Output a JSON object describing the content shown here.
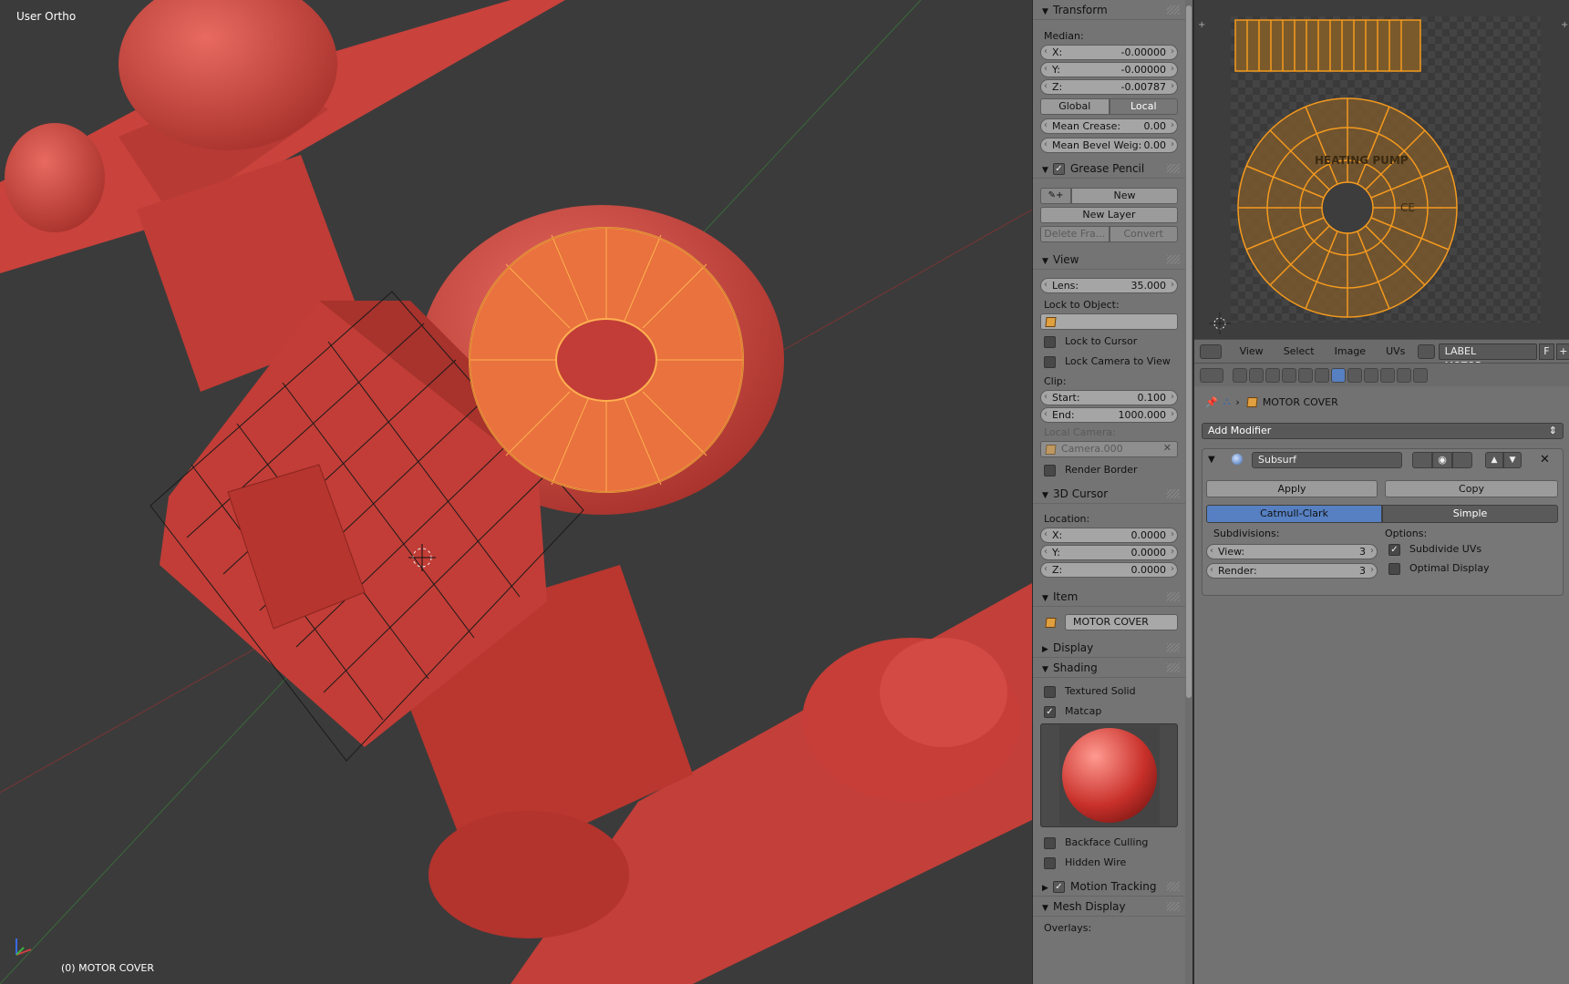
{
  "viewport": {
    "view_name": "User Ortho",
    "object_label": "(0) MOTOR COVER"
  },
  "transform": {
    "title": "Transform",
    "median_label": "Median:",
    "x": {
      "k": "X:",
      "v": "-0.00000"
    },
    "y": {
      "k": "Y:",
      "v": "-0.00000"
    },
    "z": {
      "k": "Z:",
      "v": "-0.00787"
    },
    "global": "Global",
    "local": "Local",
    "mean_crease": {
      "k": "Mean Crease:",
      "v": "0.00"
    },
    "mean_bevel": {
      "k": "Mean Bevel Weig:",
      "v": "0.00"
    }
  },
  "grease": {
    "title": "Grease Pencil",
    "new": "New",
    "new_layer": "New Layer",
    "delete_frame": "Delete Fra...",
    "convert": "Convert"
  },
  "view": {
    "title": "View",
    "lens": {
      "k": "Lens:",
      "v": "35.000"
    },
    "lock_object": "Lock to Object:",
    "lock_cursor": "Lock to Cursor",
    "lock_camera": "Lock Camera to View",
    "clip": "Clip:",
    "start": {
      "k": "Start:",
      "v": "0.100"
    },
    "end": {
      "k": "End:",
      "v": "1000.000"
    },
    "local_camera": "Local Camera:",
    "camera_value": "Camera.000",
    "render_border": "Render Border"
  },
  "cursor": {
    "title": "3D Cursor",
    "location": "Location:",
    "x": {
      "k": "X:",
      "v": "0.0000"
    },
    "y": {
      "k": "Y:",
      "v": "0.0000"
    },
    "z": {
      "k": "Z:",
      "v": "0.0000"
    }
  },
  "item": {
    "title": "Item",
    "name": "MOTOR COVER"
  },
  "display": {
    "title": "Display"
  },
  "shading": {
    "title": "Shading",
    "textured": "Textured Solid",
    "matcap": "Matcap",
    "backface": "Backface Culling",
    "hidden_wire": "Hidden Wire"
  },
  "motion": {
    "title": "Motion Tracking"
  },
  "mesh_display": {
    "title": "Mesh Display",
    "overlays": "Overlays:"
  },
  "uv_header": {
    "view": "View",
    "select": "Select",
    "image": "Image",
    "uvs": "UVs",
    "image_name": "LABEL MOTOR.png",
    "f": "F"
  },
  "uv_texture": {
    "label_text": "HEATING PUMP",
    "ce": "CE"
  },
  "properties": {
    "object_name": "MOTOR COVER",
    "add_modifier": "Add Modifier",
    "modifier_name": "Subsurf",
    "apply": "Apply",
    "copy": "Copy",
    "catmull": "Catmull-Clark",
    "simple": "Simple",
    "subdivisions": "Subdivisions:",
    "options": "Options:",
    "view": {
      "k": "View:",
      "v": "3"
    },
    "render": {
      "k": "Render:",
      "v": "3"
    },
    "subdivide_uvs": "Subdivide UVs",
    "optimal_display": "Optimal Display"
  },
  "colors": {
    "accent": "#5680c2",
    "selection": "#f0a030",
    "model": "#d04440"
  }
}
